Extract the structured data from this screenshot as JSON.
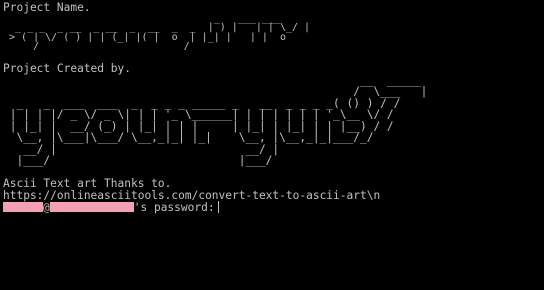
{
  "terminal": {
    "project_name_label": "Project Name.",
    "project_name_art": [
      "                                   _   ___ ___",
      "  _ _ _  _ __  _ __  _  __  _  _  | ) |   | | \\_/ |",
      " > ( | \\/ ( ) | | (_| |( |  o  | |_| |   | |  o",
      "     /                        /"
    ],
    "project_created_label": "Project Created by.",
    "creator_art": [
      "                                                     __  _____",
      "                                                    /  \\___   |",
      "  _   _  ___  ___  _  _ _ _ _____ _   __  _ _ _ _( () ) / /",
      " | | | |/ _ \\/ _ \\| | | '_ \\______| | | | | | | '_\\__ \\/ /",
      " | |_| |  __/ (_) | |_| | | |     | |_| | |_| | | |__) / /",
      "  \\__, |\\___|\\___/ \\__,_|_| |_|    \\__, |\\__,_|_|___/_/",
      "   __/ |                            __/ |",
      "  |___/                            |___/"
    ],
    "thanks_label": "Ascii Text art Thanks to.",
    "thanks_url": "https://onlineasciitools.com/convert-text-to-ascii-art\\n",
    "prompt_at": "@",
    "prompt_suffix": "'s password:",
    "colors": {
      "background": "#000000",
      "foreground": "#c0c0c0",
      "redaction": "#f4a0b4"
    }
  }
}
